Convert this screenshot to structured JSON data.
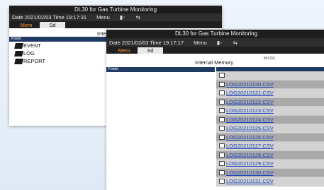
{
  "back_window": {
    "title": "DL30 for Gas Turbine Monitoring",
    "status": {
      "datetime": "Date 2021/02/03 Time 19:17:31",
      "menu": "Menu"
    },
    "tabs": {
      "mem": "Mem",
      "sd": "Sd"
    },
    "panel_title": "Inte",
    "folder_header": "Folder",
    "folders": [
      "EVENT",
      "LOG",
      "REPORT"
    ]
  },
  "front_window": {
    "title": "DL30 for Gas Turbine Monitoring",
    "status": {
      "datetime": "Date 2021/02/03 Time 19:17:17",
      "menu": "Menu"
    },
    "tabs": {
      "mem": "Mem",
      "sd": "Sd"
    },
    "panel_title": "Internal Memory",
    "path_badge": "M:LOG",
    "folder_header": "Folder",
    "parent_entry": "..",
    "files": [
      "LOG20210120.CSV",
      "LOG20210121.CSV",
      "LOG20210122.CSV",
      "LOG20210123.CSV",
      "LOG20210124.CSV",
      "LOG20210125.CSV",
      "LOG20210126.CSV",
      "LOG20210127.CSV",
      "LOG20210128.CSV",
      "LOG20210129.CSV",
      "LOG20210130.CSV",
      "LOG20210131.CSV"
    ]
  },
  "icons": {
    "sd_card": "sd-card-icon",
    "recording": "record-icon",
    "folder": "folder-icon",
    "file": "file-icon"
  }
}
